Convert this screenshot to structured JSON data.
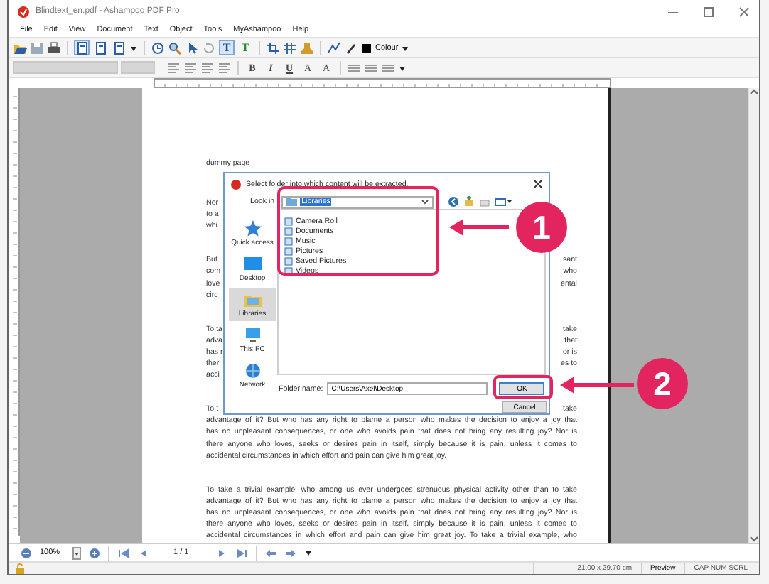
{
  "window": {
    "title": "Blindtext_en.pdf - Ashampoo PDF Pro"
  },
  "menu": [
    "File",
    "Edit",
    "View",
    "Document",
    "Text",
    "Object",
    "Tools",
    "MyAshampoo",
    "Help"
  ],
  "toolbar": {
    "view_modes": [
      {
        "selected": true
      },
      {
        "selected": false
      },
      {
        "selected": false
      }
    ],
    "text_tools": [
      {
        "label": "T",
        "selected": true
      },
      {
        "label": "T",
        "selected": false
      }
    ],
    "colour_label": "Colour"
  },
  "format_bar": {
    "styles": [
      "B",
      "I",
      "U",
      "A",
      "A"
    ]
  },
  "document": {
    "paragraphs": [
      {
        "lines": [
          {
            "kind": "split",
            "left": "dummy page"
          }
        ]
      },
      {
        "lines": [
          {
            "kind": "split",
            "left": "Nor"
          },
          {
            "kind": "split",
            "left": "to a"
          },
          {
            "kind": "split",
            "left": "whi"
          }
        ]
      },
      {
        "lines": [
          {
            "kind": "split",
            "left": "But",
            "right": "sant"
          },
          {
            "kind": "split",
            "left": "com",
            "right": "who"
          },
          {
            "kind": "split",
            "left": "love",
            "right": "ental"
          },
          {
            "kind": "split",
            "left": "circ"
          }
        ]
      },
      {
        "lines": [
          {
            "kind": "split",
            "left": "To ta",
            "right": "take"
          },
          {
            "kind": "split",
            "left": "adva",
            "right": "that"
          },
          {
            "kind": "split",
            "left": "has r",
            "right": "or is"
          },
          {
            "kind": "split",
            "left": "ther",
            "right": "es to"
          },
          {
            "kind": "split",
            "left": "acci"
          }
        ]
      },
      {
        "lines": [
          {
            "kind": "split",
            "left": "To t",
            "right": "take"
          },
          {
            "kind": "full",
            "text": "advantage of it? But who has any right to blame a person who makes the decision to enjoy a joy that"
          },
          {
            "kind": "full",
            "text": "has no unpleasant consequences, or one who avoids pain that does not bring any resulting joy? Nor is"
          },
          {
            "kind": "full",
            "text": "there anyone who loves, seeks or desires pain in itself, simply because it is pain, unless it comes to"
          },
          {
            "kind": "last",
            "text": "accidental circumstances in which effort and pain can give him great joy."
          }
        ]
      },
      {
        "lines": [
          {
            "kind": "full",
            "text": "To take a trivial example, who among us ever undergoes strenuous physical activity other than to take"
          },
          {
            "kind": "full",
            "text": "advantage of it? But who has any right to blame a person who makes the decision to enjoy a joy that"
          },
          {
            "kind": "full",
            "text": "has no unpleasant consequences, or one who avoids pain that does not bring any resulting joy? Nor is"
          },
          {
            "kind": "full",
            "text": "there anyone who loves, seeks or desires pain in itself, simply because it is pain, unless it comes to"
          },
          {
            "kind": "full",
            "text": "accidental circumstances in which effort and pain can give him great joy. To take a trivial example, who"
          }
        ]
      }
    ]
  },
  "dialog": {
    "title": "Select folder into which content will be extracted.",
    "look_in_label": "Look in",
    "look_in_value": "Libraries",
    "places": [
      {
        "label": "Quick access",
        "selected": false
      },
      {
        "label": "Desktop",
        "selected": false
      },
      {
        "label": "Libraries",
        "selected": true
      },
      {
        "label": "This PC",
        "selected": false
      },
      {
        "label": "Network",
        "selected": false
      }
    ],
    "items": [
      "Camera Roll",
      "Documents",
      "Music",
      "Pictures",
      "Saved Pictures",
      "Videos"
    ],
    "folder_name_label": "Folder name:",
    "folder_name": "C:\\Users\\Axel\\Desktop",
    "ok": "OK",
    "cancel": "Cancel"
  },
  "annotations": [
    {
      "number": "1"
    },
    {
      "number": "2"
    }
  ],
  "zoom_bar": {
    "zoom": "100%",
    "page": "1 / 1"
  },
  "status_bar": {
    "size": "21.00 x 29.70 cm",
    "mode": "Preview",
    "keys": "CAP NUM SCRL"
  }
}
